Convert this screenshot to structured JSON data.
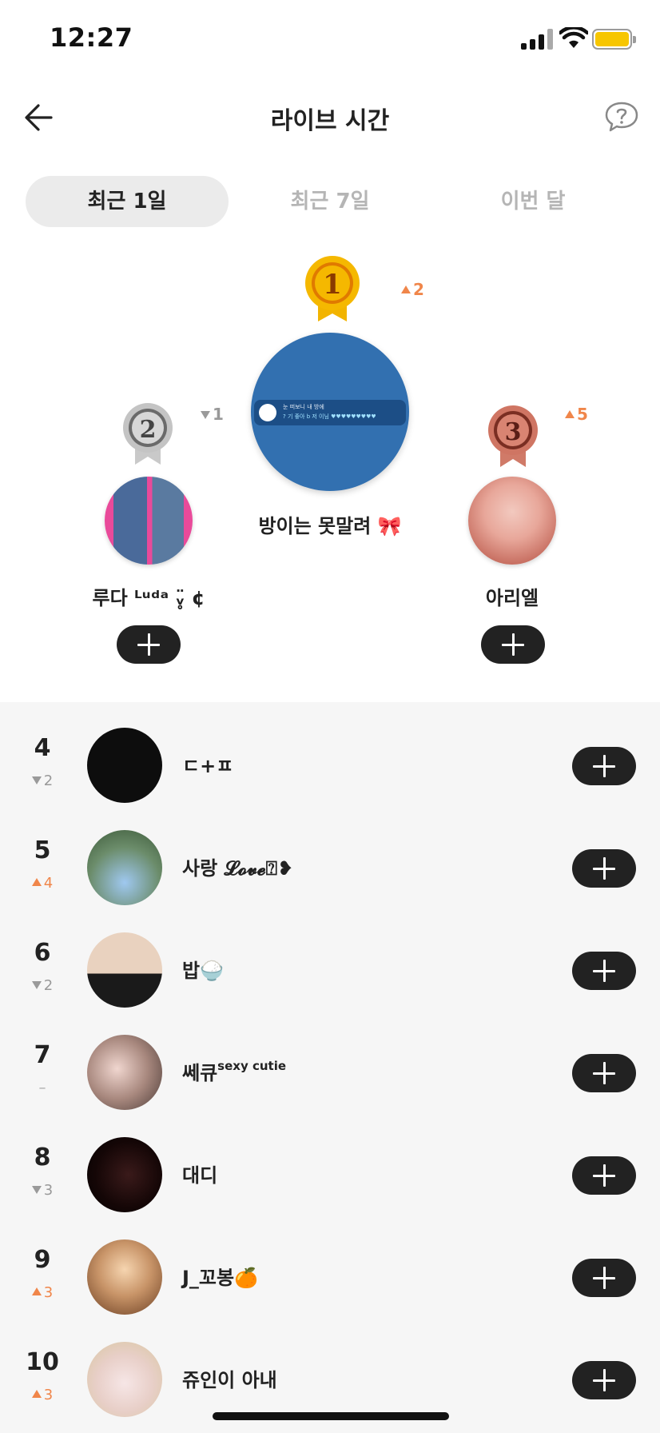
{
  "status_bar": {
    "time": "12:27",
    "battery_color": "#f7c600"
  },
  "header": {
    "title": "라이브 시간",
    "back_icon": "arrow-left-icon",
    "help_icon": "help-bubble-icon"
  },
  "tabs": [
    {
      "label": "최근 1일",
      "active": true
    },
    {
      "label": "최근 7일",
      "active": false
    },
    {
      "label": "이번 달",
      "active": false
    }
  ],
  "podium": {
    "first": {
      "rank": "1",
      "name": "방이는 못말려 🎀",
      "change": "2",
      "direction": "up"
    },
    "second": {
      "rank": "2",
      "name": "루다 ᴸᵘᵈᵃ ᵥ̥̈ ¢",
      "change": "1",
      "direction": "down"
    },
    "third": {
      "rank": "3",
      "name": "아리엘",
      "change": "5",
      "direction": "up"
    },
    "avatar_chat_text_line1": "눈 떠보니 내 방에",
    "avatar_chat_text_line2": "? 기 좋아 b 저 이님 ♥♥♥♥♥♥♥♥♥"
  },
  "list": [
    {
      "rank": "4",
      "change": "2",
      "direction": "down",
      "name": "ㄷ+ㅍ",
      "suffix": ""
    },
    {
      "rank": "5",
      "change": "4",
      "direction": "up",
      "name": "사랑 𝓛𝓸𝓿𝓮⍰❥",
      "suffix": ""
    },
    {
      "rank": "6",
      "change": "2",
      "direction": "down",
      "name": "밥🍚",
      "suffix": ""
    },
    {
      "rank": "7",
      "change": "–",
      "direction": "same",
      "name": "쎄큐",
      "suffix": "sexy cutie"
    },
    {
      "rank": "8",
      "change": "3",
      "direction": "down",
      "name": "대디",
      "suffix": ""
    },
    {
      "rank": "9",
      "change": "3",
      "direction": "up",
      "name": "J_꼬봉🍊",
      "suffix": ""
    },
    {
      "rank": "10",
      "change": "3",
      "direction": "up",
      "name": "쥬인이 아내",
      "suffix": ""
    }
  ],
  "colors": {
    "accent_up": "#f0864a",
    "down": "#999999",
    "button": "#222222",
    "list_bg": "#f6f6f6",
    "gold": "#f5b800",
    "silver": "#b8b8b8",
    "bronze": "#c96b5a"
  }
}
